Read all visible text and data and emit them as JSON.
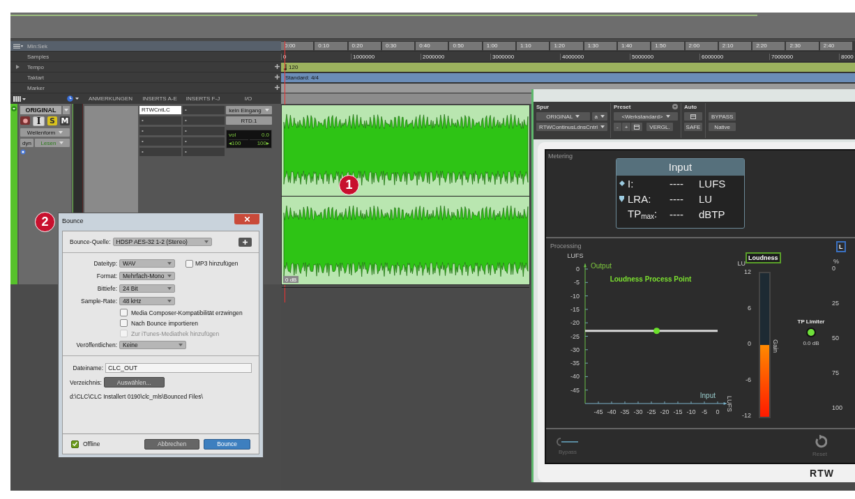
{
  "rulers": [
    {
      "label": "Min:Sek",
      "kind": "time",
      "selected": true,
      "ticks": [
        "0:00",
        "0:10",
        "0:20",
        "0:30",
        "0:40",
        "0:50",
        "1:00",
        "1:10",
        "1:20",
        "1:30",
        "1:40",
        "1:50",
        "2:00",
        "2:10",
        "2:20",
        "2:30",
        "2:40"
      ]
    },
    {
      "label": "Samples",
      "kind": "samples",
      "selected": false,
      "ticks": [
        "0",
        "1000000",
        "2000000",
        "3000000",
        "4000000",
        "5000000",
        "6000000",
        "7000000",
        "8000"
      ]
    },
    {
      "label": "Tempo",
      "kind": "tempo",
      "selected": false,
      "value": "120"
    },
    {
      "label": "Taktart",
      "kind": "meter",
      "selected": false,
      "value": "Standard: 4/4"
    },
    {
      "label": "Marker",
      "kind": "marker",
      "selected": false
    }
  ],
  "columns": [
    "ANMERKUNGEN",
    "INSERTS A-E",
    "INSERTS F-J",
    "I/O"
  ],
  "track": {
    "name": "ORIGINAL",
    "buttons": [
      {
        "label": "I",
        "kind": "input",
        "on": false
      },
      {
        "label": "S",
        "kind": "solo",
        "on": true
      },
      {
        "label": "M",
        "kind": "mute",
        "on": false
      }
    ],
    "view": "Wellenform",
    "dyn": "dyn",
    "automation": "Lesen",
    "inserts_a_e": [
      {
        "label": "RTWCntLC",
        "active": true
      },
      {
        "label": "•",
        "active": false
      },
      {
        "label": "•",
        "active": false
      },
      {
        "label": "•",
        "active": false
      },
      {
        "label": "•",
        "active": false
      }
    ],
    "inserts_f_j": [
      {
        "label": "•",
        "active": false
      },
      {
        "label": "•",
        "active": false
      },
      {
        "label": "•",
        "active": false
      },
      {
        "label": "•",
        "active": false
      },
      {
        "label": "•",
        "active": false
      }
    ],
    "input": "kein Eingang",
    "output": "RTD.1",
    "volume_label": "vol",
    "volume": "0.0",
    "pan_left": "◂100",
    "pan_right": "100▸"
  },
  "clip": {
    "gain": "0 dB",
    "callout": "1"
  },
  "bounce": {
    "title": "Bounce",
    "callout": "2",
    "source_label": "Bounce-Quelle:",
    "source": "HDSP AES-32 1-2 (Stereo)",
    "fields": [
      {
        "label": "Dateityp:",
        "value": "WAV"
      },
      {
        "label": "Format:",
        "value": "Mehrfach-Mono"
      },
      {
        "label": "Bittiefe:",
        "value": "24 Bit"
      },
      {
        "label": "Sample-Rate:",
        "value": "48 kHz"
      }
    ],
    "mp3": {
      "label": "MP3 hinzufügen",
      "checked": false
    },
    "options": [
      {
        "label": "Media Composer-Kompatibilität erzwingen",
        "checked": false,
        "disabled": false
      },
      {
        "label": "Nach Bounce importieren",
        "checked": false,
        "disabled": false
      },
      {
        "label": "Zur iTunes-Mediathek hinzufügen",
        "checked": false,
        "disabled": true
      }
    ],
    "publish_label": "Veröffentlichen:",
    "publish": "Keine",
    "filename_label": "Dateiname:",
    "filename": "CLC_OUT",
    "directory_label": "Verzeichnis:",
    "directory_button": "Auswählen...",
    "path": "d:\\CLC\\CLC Installert 0190\\clc_mls\\Bounced Files\\",
    "offline": {
      "label": "Offline",
      "checked": true
    },
    "buttons": [
      {
        "label": "Abbrechen",
        "kind": "cancel"
      },
      {
        "label": "Bounce",
        "kind": "primary"
      }
    ]
  },
  "plugin": {
    "track_label": "Spur",
    "track": "ORIGINAL",
    "track_letter": "a",
    "plugin": "RTWContinusLdnsCntrl",
    "preset_label": "Preset",
    "preset": "<Werkstandard>",
    "preset_minus": "-",
    "preset_plus": "+",
    "compare": "VERGL.",
    "auto_label": "Auto",
    "safe": "SAFE",
    "bypass": "BYPASS",
    "native": "Native",
    "metering": {
      "title": "Metering",
      "box_title": "Input",
      "rows": [
        {
          "label": "I:",
          "value": "----",
          "unit": "LUFS",
          "kind": "diamond"
        },
        {
          "label": "LRA:",
          "value": "----",
          "unit": "LU",
          "kind": "drop"
        },
        {
          "label": "TP$_{max}$:",
          "value": "----",
          "unit": "dBTP",
          "kind": "plain"
        }
      ]
    },
    "processing": {
      "title": "Processing",
      "y_unit": "LUFS",
      "x_unit": "LUFS",
      "chart_data": {
        "type": "line",
        "title": "Loudness Process Point",
        "xlabel": "Input",
        "ylabel": "Output",
        "x": [
          -50,
          -23,
          0
        ],
        "series": [
          {
            "color": "#d8d8d8",
            "values": [
              -23,
              -23,
              -23
            ]
          }
        ],
        "xlim": [
          -50,
          2
        ],
        "ylim": [
          -50,
          2
        ],
        "xticks": [
          -45,
          -40,
          -35,
          -30,
          -25,
          -20,
          -15,
          -10,
          -5,
          0
        ],
        "yticks": [
          0,
          -5,
          -10,
          -15,
          -20,
          -25,
          -30,
          -35,
          -40,
          -45
        ]
      },
      "loudness_meter": {
        "tag": "Loudness",
        "unit": "LU",
        "ticks": [
          "12",
          "6",
          "0",
          "-6",
          "-12"
        ],
        "axis_label": "Gain",
        "level": 0.5
      },
      "tp_limiter": {
        "label": "TP Limiter",
        "on": true,
        "value": "0.0 dB"
      },
      "second_meter": {
        "tag": "L",
        "unit": "%",
        "ticks": [
          "0",
          "25",
          "50",
          "75",
          "100"
        ]
      }
    },
    "bypass_label": "Bypass",
    "reset_label": "Reset",
    "logo": "RTW"
  }
}
